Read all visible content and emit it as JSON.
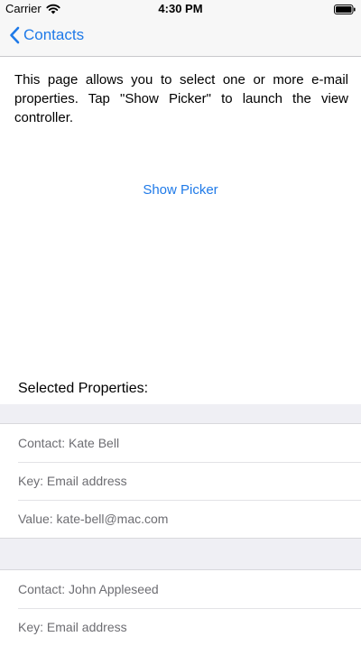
{
  "status_bar": {
    "carrier": "Carrier",
    "time": "4:30 PM",
    "icons": [
      "wifi-icon",
      "battery-icon"
    ]
  },
  "nav": {
    "back_label": "Contacts",
    "back_icon": "chevron-left-icon"
  },
  "intro_text": "This page allows you to select one or more e-mail properties. Tap \"Show Picker\" to launch the view controller.",
  "show_picker_label": "Show Picker",
  "selected_title": "Selected Properties:",
  "contacts": [
    {
      "contact": "Contact: Kate Bell",
      "key": "Key: Email address",
      "value": "Value: kate-bell@mac.com"
    },
    {
      "contact": "Contact: John Appleseed",
      "key": "Key: Email address"
    }
  ],
  "colors": {
    "accent": "#1f7ae8",
    "grouped_background": "#efeff4",
    "secondary_text": "#6d6d72"
  }
}
